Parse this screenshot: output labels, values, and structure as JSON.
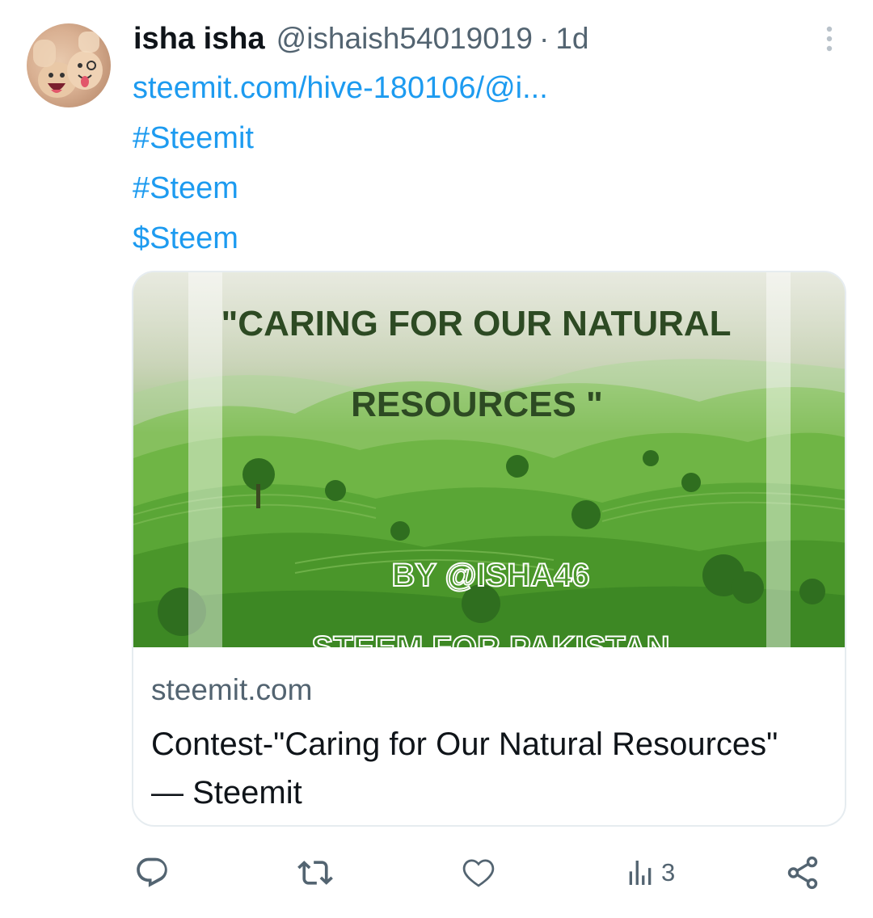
{
  "tweet": {
    "author_name": "isha isha",
    "author_handle": "@ishaish54019019",
    "separator": "·",
    "time": "1d",
    "lines": [
      "steemit.com/hive-180106/@i...",
      "#Steemit",
      "#Steem",
      "$Steem"
    ]
  },
  "card": {
    "image_text": {
      "title_line1": "\"CARING FOR OUR NATURAL",
      "title_line2": "RESOURCES \"",
      "byline": "BY @ISHA46",
      "footer": "STEEM FOR PAKISTAN"
    },
    "domain": "steemit.com",
    "title": "Contest-\"Caring for Our Natural Resources\" — Steemit"
  },
  "actions": {
    "views_count": "3",
    "icons": [
      "reply-icon",
      "retweet-icon",
      "like-icon",
      "views-icon",
      "share-icon"
    ]
  },
  "colors": {
    "link": "#1d9bf0",
    "secondary_text": "#536471",
    "border": "#e6ecf0"
  }
}
